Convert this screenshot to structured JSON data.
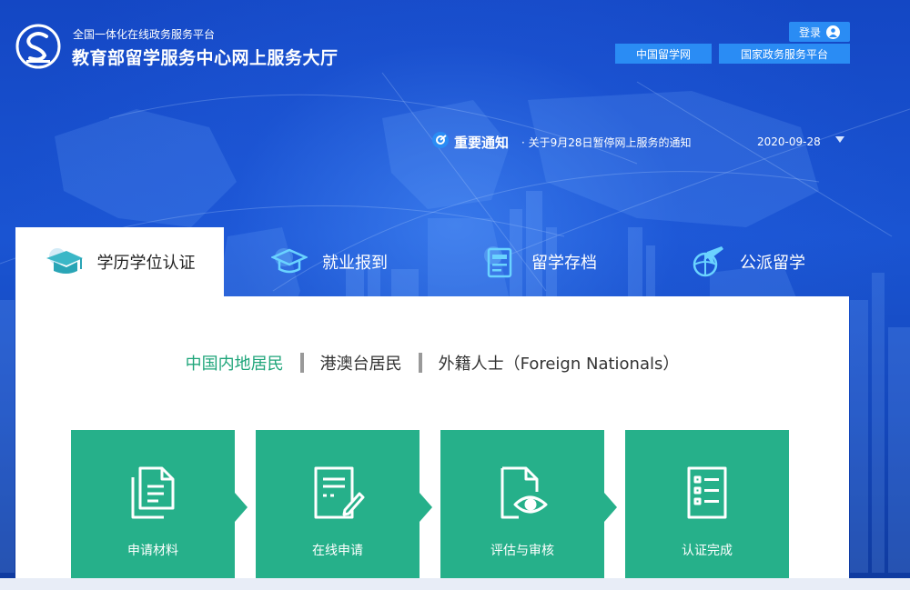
{
  "header": {
    "tagline": "全国一体化在线政务服务平台",
    "site_title": "教育部留学服务中心网上服务大厅",
    "login_label": "登录",
    "links": [
      {
        "label": "中国留学网"
      },
      {
        "label": "国家政务服务平台"
      }
    ]
  },
  "notice": {
    "title": "重要通知",
    "text": "· 关于9月28日暂停网上服务的通知",
    "date": "2020-09-28"
  },
  "tabs": [
    {
      "label": "学历学位认证",
      "icon": "graduation-cap-icon",
      "active": true
    },
    {
      "label": "就业报到",
      "icon": "graduation-cap-outline-icon",
      "active": false
    },
    {
      "label": "留学存档",
      "icon": "archive-document-icon",
      "active": false
    },
    {
      "label": "公派留学",
      "icon": "globe-airplane-icon",
      "active": false
    }
  ],
  "subtabs": [
    {
      "label": "中国内地居民",
      "active": true
    },
    {
      "label": "港澳台居民",
      "active": false
    },
    {
      "label": "外籍人士（Foreign Nationals）",
      "active": false
    }
  ],
  "steps": [
    {
      "label": "申请材料",
      "icon": "documents-icon"
    },
    {
      "label": "在线申请",
      "icon": "form-edit-icon"
    },
    {
      "label": "评估与审核",
      "icon": "document-eye-icon"
    },
    {
      "label": "认证完成",
      "icon": "checklist-icon"
    }
  ],
  "colors": {
    "background_blue": "#1a54d2",
    "button_blue": "#2a8cf4",
    "accent_green": "#26b08a",
    "active_text_green": "#1fa57a"
  }
}
